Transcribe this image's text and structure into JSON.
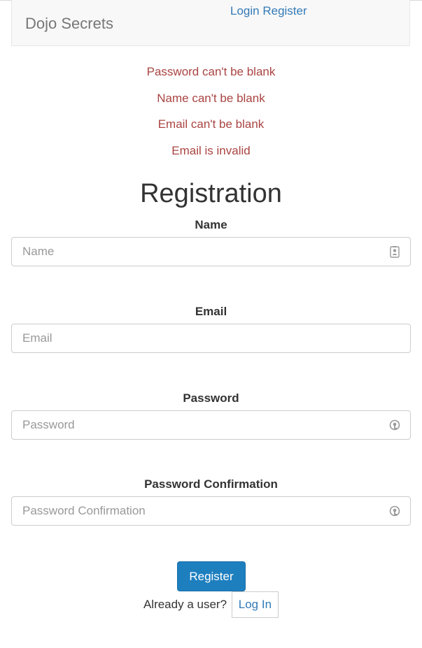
{
  "navbar": {
    "brand": "Dojo Secrets",
    "login_link": "Login",
    "register_link": "Register"
  },
  "errors": [
    "Password can't be blank",
    "Name can't be blank",
    "Email can't be blank",
    "Email is invalid"
  ],
  "form": {
    "title": "Registration",
    "name": {
      "label": "Name",
      "placeholder": "Name",
      "value": ""
    },
    "email": {
      "label": "Email",
      "placeholder": "Email",
      "value": ""
    },
    "password": {
      "label": "Password",
      "placeholder": "Password",
      "value": ""
    },
    "password_confirmation": {
      "label": "Password Confirmation",
      "placeholder": "Password Confirmation",
      "value": ""
    },
    "submit_label": "Register"
  },
  "footer": {
    "prompt": "Already a user?",
    "login_label": "Log In"
  },
  "colors": {
    "error": "#a94442",
    "link": "#337ab7",
    "primary_button": "#1e7fbf"
  },
  "icons": {
    "name_field": "contact-card-icon",
    "password_field": "password-key-icon",
    "password_confirmation_field": "password-key-icon"
  }
}
